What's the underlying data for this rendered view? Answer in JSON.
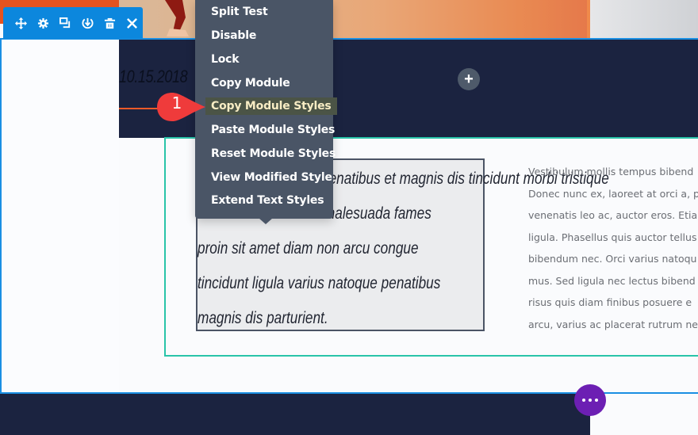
{
  "toolbar": {
    "buttons": [
      {
        "name": "move-icon",
        "label": "Move"
      },
      {
        "name": "gear-icon",
        "label": "Settings"
      },
      {
        "name": "duplicate-icon",
        "label": "Duplicate"
      },
      {
        "name": "save-icon",
        "label": "Save to Library"
      },
      {
        "name": "trash-icon",
        "label": "Delete"
      },
      {
        "name": "close-icon",
        "label": "Close"
      }
    ],
    "color": "#0c87dd"
  },
  "context_menu": {
    "items": [
      {
        "label": "Split Test",
        "active": false
      },
      {
        "label": "Disable",
        "active": false
      },
      {
        "label": "Lock",
        "active": false
      },
      {
        "label": "Copy Module",
        "active": false
      },
      {
        "label": "Copy Module Styles",
        "active": true
      },
      {
        "label": "Paste Module Styles",
        "active": false
      },
      {
        "label": "Reset Module Styles",
        "active": false
      },
      {
        "label": "View Modified Style",
        "active": false
      },
      {
        "label": "Extend Text Styles",
        "active": false
      }
    ]
  },
  "callout": {
    "number": "1",
    "color": "#ef3b3b"
  },
  "content": {
    "date": "10.15.2018",
    "quote_lines": [
      "Cum sociis natoque penatibus et magnis dis tincidunt morbi tristique",
      "senectus et netus et malesuada fames",
      "proin sit amet diam non arcu congue",
      "tincidunt ligula varius natoque penatibus",
      "magnis dis parturient."
    ],
    "quote_visible_fragments": [
      "nt morbi tristique",
      "malesuada fames"
    ],
    "body_lines": [
      "Vestibulum mollis tempus bibend",
      "Donec nunc ex, laoreet at orci a, p",
      "venenatis leo ac, auctor eros. Etia",
      "ligula. Phasellus quis auctor tellus",
      "bibendum nec. Orci varius natoqu",
      "mus. Sed ligula nec lectus bibend",
      "risus quis diam finibus posuere e",
      "arcu, varius ac placerat rutrum ne"
    ]
  },
  "buttons": {
    "add_label": "+",
    "more_label": "More options"
  },
  "colors": {
    "dark_band": "#1b2340",
    "module_outline": "#29c4a9",
    "row_outline": "#1a8fe3",
    "more_button": "#6c1fb3",
    "menu_bg": "#4a5566",
    "menu_active_text": "#f7ecc4"
  }
}
